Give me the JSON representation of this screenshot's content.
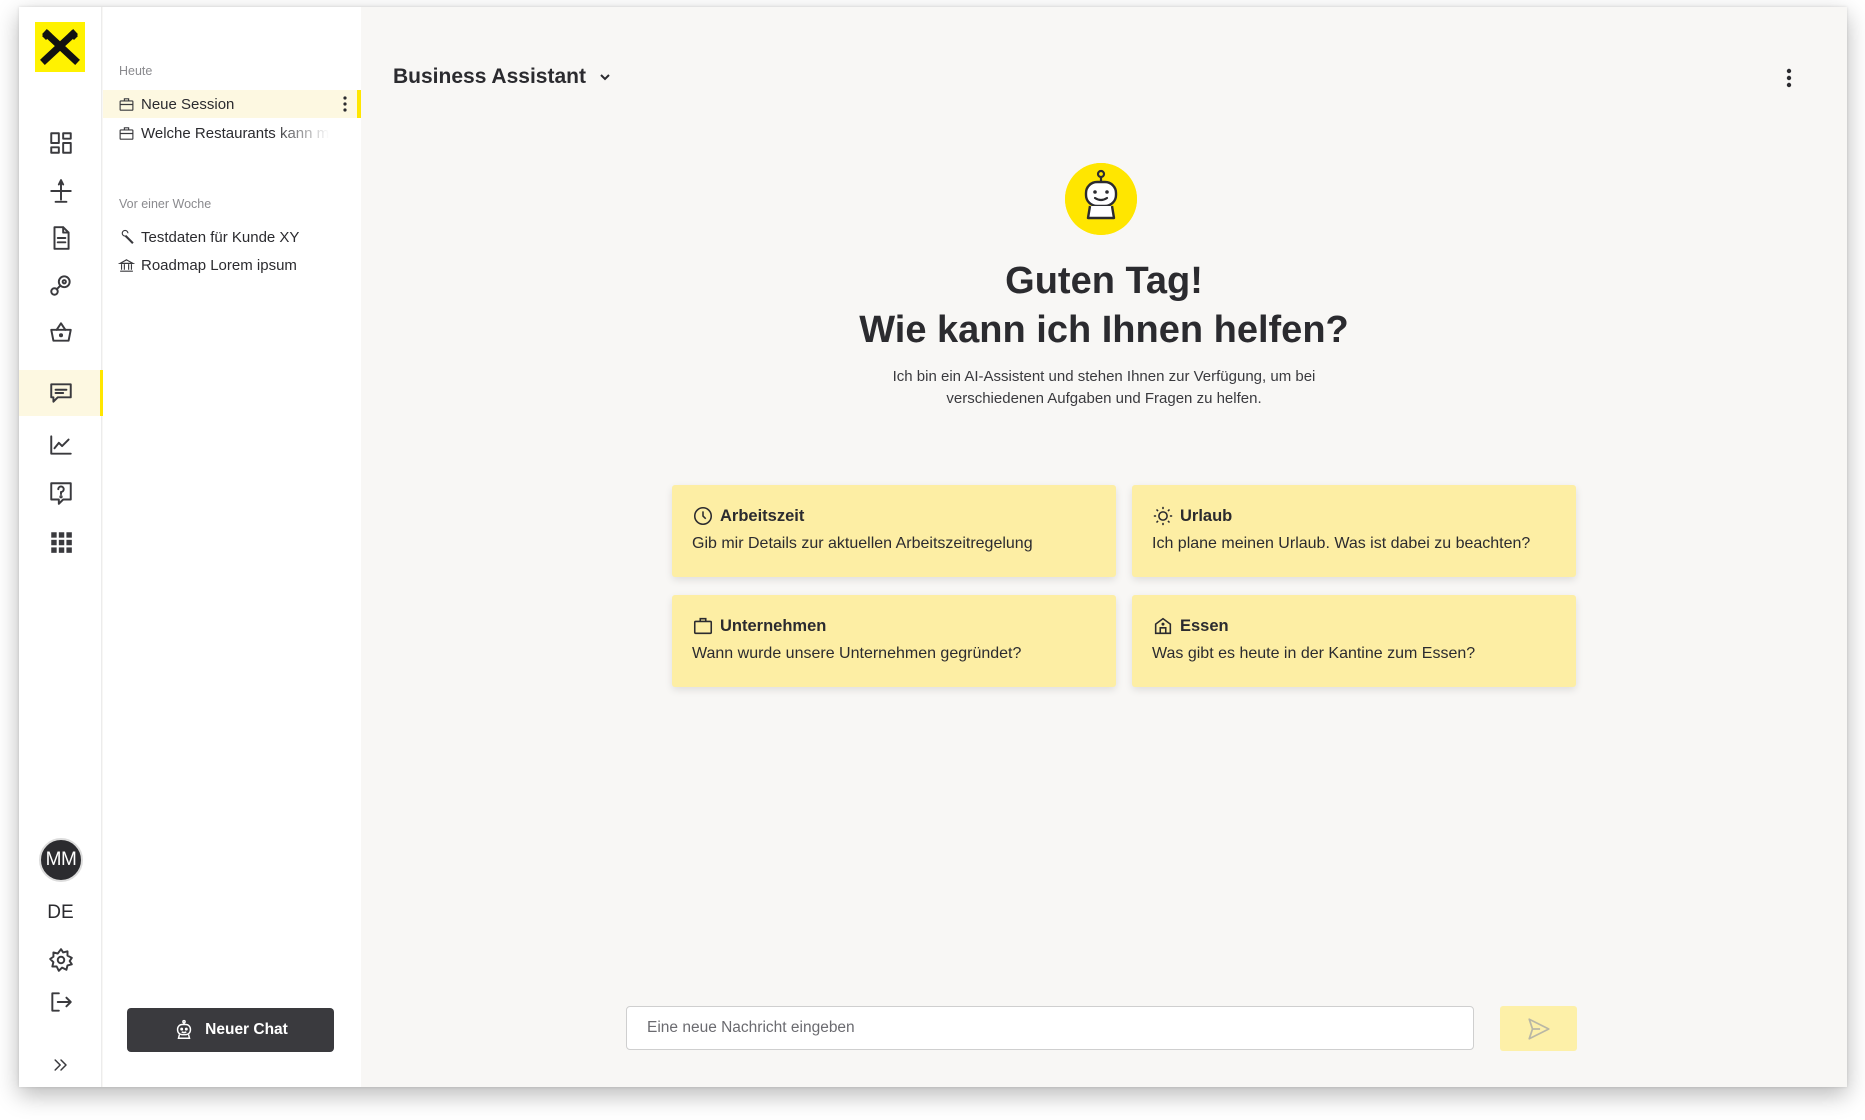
{
  "rail": {
    "logo": "raiffeisen-logo",
    "items": [
      {
        "name": "dashboard-icon"
      },
      {
        "name": "airplane-icon"
      },
      {
        "name": "document-icon"
      },
      {
        "name": "integration-icon"
      },
      {
        "name": "basket-icon"
      },
      {
        "name": "chat-icon",
        "active": true
      },
      {
        "name": "chart-icon"
      },
      {
        "name": "help-icon"
      },
      {
        "name": "apps-grid-icon"
      }
    ],
    "avatar_initials": "MM",
    "language": "DE"
  },
  "sessions": {
    "groups": [
      {
        "label": "Heute",
        "items": [
          {
            "icon": "briefcase-icon",
            "label": "Neue Session",
            "active": true
          },
          {
            "icon": "briefcase-icon",
            "label": "Welche Restaurants kann m"
          }
        ]
      },
      {
        "label": "Vor einer Woche",
        "items": [
          {
            "icon": "wrench-icon",
            "label": "Testdaten für Kunde XY"
          },
          {
            "icon": "bank-icon",
            "label": "Roadmap Lorem ipsum"
          }
        ]
      }
    ],
    "new_chat_label": "Neuer Chat"
  },
  "header": {
    "title": "Business Assistant"
  },
  "welcome": {
    "line1": "Guten Tag!",
    "line2": "Wie kann ich Ihnen helfen?",
    "sub1": "Ich bin ein AI-Assistent und stehen Ihnen zur Verfügung, um bei",
    "sub2": "verschiedenen Aufgaben und Fragen zu helfen."
  },
  "cards": [
    {
      "icon": "clock-icon",
      "title": "Arbeitszeit",
      "text": "Gib mir Details zur aktuellen Arbeitszeitregelung"
    },
    {
      "icon": "sun-icon",
      "title": "Urlaub",
      "text": "Ich plane meinen Urlaub. Was ist dabei zu beachten?"
    },
    {
      "icon": "briefcase-icon",
      "title": "Unternehmen",
      "text": "Wann wurde unsere Unternehmen gegründet?"
    },
    {
      "icon": "house-icon",
      "title": "Essen",
      "text": "Was gibt es heute in der Kantine zum Essen?"
    }
  ],
  "composer": {
    "placeholder": "Eine neue Nachricht eingeben",
    "value": ""
  },
  "colors": {
    "accent": "#ffe600",
    "card_bg": "#fdeea4",
    "dark": "#3a3a3e",
    "background": "#f8f7f5"
  }
}
